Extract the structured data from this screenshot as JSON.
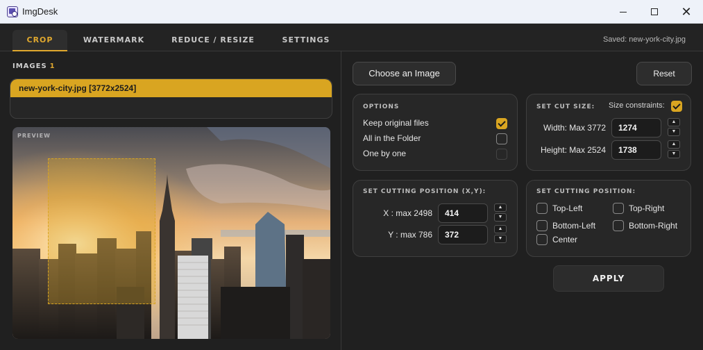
{
  "window": {
    "title": "ImgDesk",
    "minimize": "",
    "maximize": "",
    "close": "✕"
  },
  "tabs": [
    {
      "label": "CROP",
      "active": true
    },
    {
      "label": "WATERMARK",
      "active": false
    },
    {
      "label": "REDUCE / RESIZE",
      "active": false
    },
    {
      "label": "SETTINGS",
      "active": false
    }
  ],
  "status": {
    "saved": "Saved: new-york-city.jpg"
  },
  "images": {
    "label": "IMAGES",
    "count": "1",
    "items": [
      {
        "name": "new-york-city.jpg [3772x2524]",
        "selected": true
      }
    ]
  },
  "preview": {
    "label": "PREVIEW"
  },
  "toolbar": {
    "choose_label": "Choose an Image",
    "reset_label": "Reset",
    "apply_label": "APPLY"
  },
  "options": {
    "title": "OPTIONS",
    "items": [
      {
        "label": "Keep original files",
        "checked": true
      },
      {
        "label": "All in the Folder",
        "checked": false
      },
      {
        "label": "One by one",
        "checked": false
      }
    ]
  },
  "cut_size": {
    "title": "SET CUT SIZE:",
    "constraints_label": "Size constraints:",
    "constraints_checked": true,
    "width_label": "Width: Max 3772",
    "width_value": "1274",
    "height_label": "Height: Max 2524",
    "height_value": "1738"
  },
  "cut_position": {
    "title": "SET CUTTING POSITION (X,Y):",
    "x_label": "X : max 2498",
    "x_value": "414",
    "y_label": "Y : max 786",
    "y_value": "372"
  },
  "cut_preset": {
    "title": "SET CUTTING POSITION:",
    "items": [
      {
        "label": "Top-Left",
        "checked": false
      },
      {
        "label": "Top-Right",
        "checked": false
      },
      {
        "label": "Bottom-Left",
        "checked": false
      },
      {
        "label": "Bottom-Right",
        "checked": false
      },
      {
        "label": "Center",
        "checked": false
      }
    ]
  },
  "spin": {
    "up": "▲",
    "down": "▼"
  },
  "colors": {
    "accent": "#d9a521",
    "background": "#202020",
    "card": "#272727"
  }
}
